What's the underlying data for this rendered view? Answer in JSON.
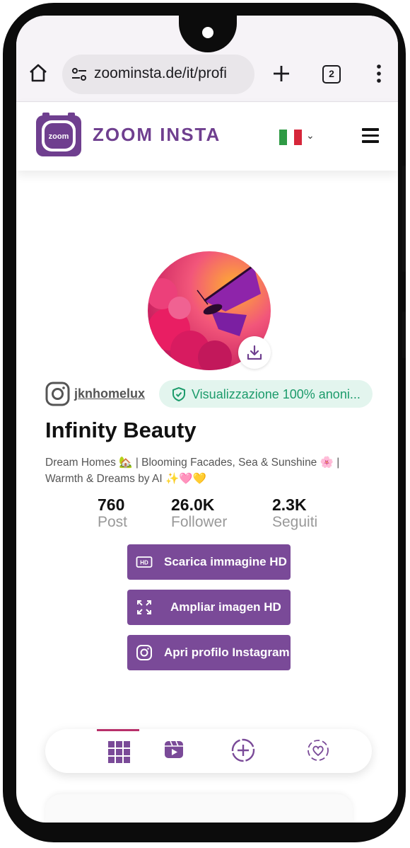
{
  "browser": {
    "url": "zoominsta.de/it/profi",
    "tab_count": "2",
    "icons": [
      "home-icon",
      "site-settings-icon",
      "new-tab-icon",
      "tab-switcher-icon",
      "more-icon"
    ]
  },
  "header": {
    "logo_text": "zoom",
    "brand": "ZOOM INSTA",
    "language_flag": "it",
    "colors": {
      "brand": "#6f3f8f",
      "accent": "#7a4a98"
    }
  },
  "profile": {
    "username": "jknhomelux",
    "anon_badge": "Visualizzazione 100% anoni...",
    "name": "Infinity Beauty",
    "bio": "Dream Homes 🏡 | Blooming Facades, Sea & Sunshine 🌸 | Warmth & Dreams by AI ✨🩷💛",
    "stats": [
      {
        "value": "760",
        "label": "Post"
      },
      {
        "value": "26.0K",
        "label": "Follower"
      },
      {
        "value": "2.3K",
        "label": "Seguiti"
      }
    ]
  },
  "actions": {
    "download_hd": "Scarica immagine HD",
    "zoom_hd": "Ampliar imagen HD",
    "open_instagram": "Apri profilo Instagram"
  },
  "tabs": {
    "active": "posts",
    "items": [
      "grid-icon",
      "reels-icon",
      "add-circle-icon",
      "heart-story-icon"
    ]
  }
}
